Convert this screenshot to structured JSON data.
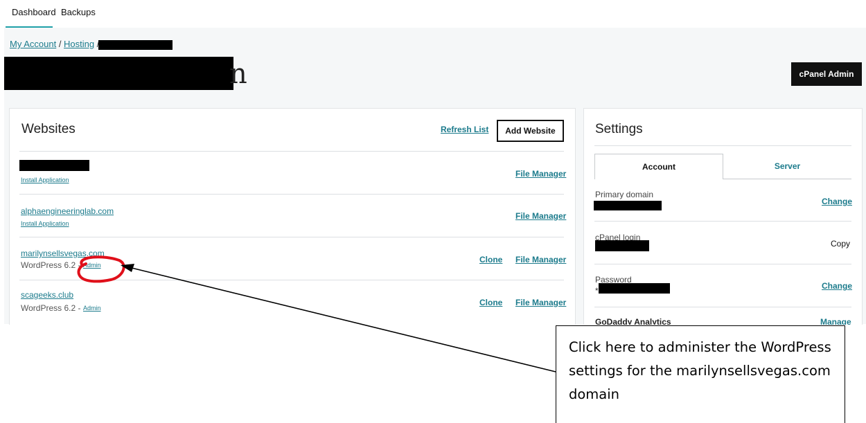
{
  "topnav": {
    "tabs": [
      "Dashboard",
      "Backups"
    ]
  },
  "breadcrumb": {
    "my_account": "My Account",
    "sep1": " / ",
    "hosting": "Hosting",
    "sep2": " /"
  },
  "header": {
    "title_tail": "n",
    "cpanel_button": "cPanel Admin"
  },
  "websites": {
    "title": "Websites",
    "refresh": "Refresh List",
    "add": "Add Website",
    "rows": [
      {
        "sub": "Install Application",
        "file_manager": "File Manager"
      },
      {
        "name": "alphaengineeringlab.com",
        "sub": "Install Application",
        "file_manager": "File Manager"
      },
      {
        "name": "marilynsellsvegas.com",
        "meta": "WordPress 6.2 -",
        "admin": "Admin",
        "clone": "Clone",
        "file_manager": "File Manager"
      },
      {
        "name": "scageeks.club",
        "meta": "WordPress 6.2 -",
        "admin": "Admin",
        "clone": "Clone",
        "file_manager": "File Manager"
      }
    ]
  },
  "settings": {
    "title": "Settings",
    "tabs": [
      "Account",
      "Server"
    ],
    "items": [
      {
        "label": "Primary domain",
        "action": "Change"
      },
      {
        "label": "cPanel login",
        "action": "Copy"
      },
      {
        "label": "Password",
        "value_prefix": "*",
        "action": "Change"
      },
      {
        "label": "GoDaddy Analytics",
        "action": "Manage"
      }
    ]
  },
  "callout": {
    "text": "Click here to administer the WordPress settings for the marilynsellsvegas.com domain"
  },
  "colors": {
    "link": "#1c7b8c",
    "tab_underline": "#1ea0a8",
    "annotation_circle": "#e0101a",
    "page_bg": "#f5f7f8"
  }
}
